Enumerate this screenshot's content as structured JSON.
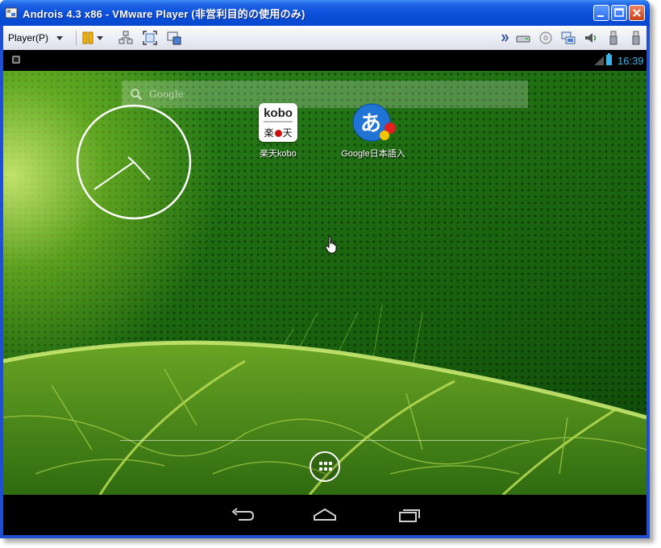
{
  "window": {
    "title": "Androis 4.3 x86 - VMware Player (非営利目的の使用のみ)",
    "controls": [
      "minimize",
      "maximize",
      "close"
    ]
  },
  "toolbar": {
    "player_menu_label": "Player(P)",
    "tools": [
      "pause-icon",
      "network-icon",
      "fullscreen-icon",
      "unity-icon"
    ],
    "devices": [
      "expand-icon",
      "hard-disk-icon",
      "cd-icon",
      "network-adapter-icon",
      "sound-icon",
      "usb-icon",
      "usb-icon"
    ]
  },
  "statusbar": {
    "time": "16:39"
  },
  "home": {
    "search_placeholder": "Google",
    "apps": [
      {
        "label": "楽天kobo",
        "icon": "kobo-icon",
        "icon_top": "kobo",
        "icon_bottom_left": "楽",
        "icon_bottom_right": "天"
      },
      {
        "label": "Google日本語入",
        "icon": "google-japanese-input-icon",
        "icon_glyph": "あ"
      }
    ]
  },
  "navbar": {
    "buttons": [
      "back-icon",
      "home-icon",
      "recent-apps-icon"
    ]
  },
  "colors": {
    "title_bar": "#0a4fd8",
    "status_accent": "#3ab3e8",
    "wallpaper": "#1f6c12",
    "close_button": "#c94218"
  }
}
